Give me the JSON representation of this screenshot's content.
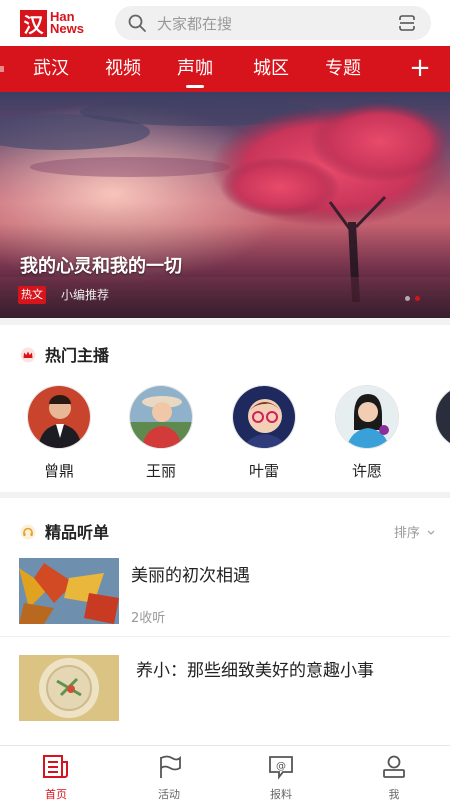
{
  "header": {
    "logo": {
      "mark": "汉",
      "line1": "Han",
      "line2": "News"
    },
    "search": {
      "placeholder": "大家都在搜",
      "icon": "search-icon",
      "right_icon": "scan-icon"
    }
  },
  "nav": {
    "tabs": [
      {
        "label": "武汉",
        "active": false
      },
      {
        "label": "视频",
        "active": false
      },
      {
        "label": "声咖",
        "active": true
      },
      {
        "label": "城区",
        "active": false
      },
      {
        "label": "专题",
        "active": false
      }
    ],
    "add_label": "+"
  },
  "banner": {
    "title": "我的心灵和我的一切",
    "tag": "热文",
    "subtitle": "小编推荐",
    "dot_count": 2,
    "active_dot": 1
  },
  "anchors": {
    "title": "热门主播",
    "icon": "crown-icon",
    "items": [
      {
        "name": "曾鼎"
      },
      {
        "name": "王丽"
      },
      {
        "name": "叶雷"
      },
      {
        "name": "许愿"
      }
    ]
  },
  "playlists": {
    "title": "精品听单",
    "icon": "headphones-icon",
    "sort_label": "排序",
    "items": [
      {
        "title": "美丽的初次相遇",
        "meta": "2收听"
      },
      {
        "title": "养小：那些细致美好的意趣小事",
        "meta": ""
      }
    ]
  },
  "tabbar": {
    "items": [
      {
        "label": "首页",
        "icon": "news-icon",
        "active": true
      },
      {
        "label": "活动",
        "icon": "flag-icon",
        "active": false
      },
      {
        "label": "报料",
        "icon": "report-icon",
        "active": false
      },
      {
        "label": "我",
        "icon": "user-icon",
        "active": false
      }
    ]
  },
  "colors": {
    "brand": "#d7141b",
    "muted": "#999999"
  }
}
